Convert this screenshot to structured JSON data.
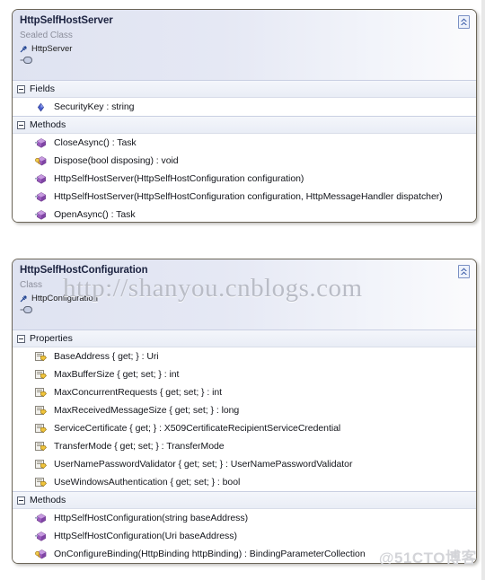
{
  "diagram": {
    "kind": "class-diagram",
    "background_color": "#ffffff",
    "accent_color": "#dfe3f1",
    "border_color": "#6b6558",
    "collapse_icon": "chevron-up-double-icon",
    "expander_icon": "minus-box-icon",
    "base_arrow_icon": "inheritance-arrow-icon",
    "lollipop_icon": "interface-lollipop-icon"
  },
  "watermarks": {
    "url": "http://shanyou.cnblogs.com",
    "site": "@51CTO博客"
  },
  "shapes": [
    {
      "title": "HttpSelfHostServer",
      "stereotype": "Sealed Class",
      "base": "HttpServer",
      "collapse_label": " ",
      "compartments": [
        {
          "label": "Fields",
          "members": [
            {
              "icon": "field-icon",
              "text": "SecurityKey : string"
            }
          ]
        },
        {
          "label": "Methods",
          "members": [
            {
              "icon": "method-icon",
              "text": "CloseAsync() : Task"
            },
            {
              "icon": "method-protected-icon",
              "text": "Dispose(bool disposing) : void"
            },
            {
              "icon": "method-icon",
              "text": "HttpSelfHostServer(HttpSelfHostConfiguration configuration)"
            },
            {
              "icon": "method-icon",
              "text": "HttpSelfHostServer(HttpSelfHostConfiguration configuration, HttpMessageHandler dispatcher)"
            },
            {
              "icon": "method-icon",
              "text": "OpenAsync() : Task"
            }
          ]
        }
      ]
    },
    {
      "title": "HttpSelfHostConfiguration",
      "stereotype": "Class",
      "base": "HttpConfiguration",
      "collapse_label": " ",
      "compartments": [
        {
          "label": "Properties",
          "members": [
            {
              "icon": "property-icon",
              "text": "BaseAddress { get; } : Uri"
            },
            {
              "icon": "property-icon",
              "text": "MaxBufferSize { get; set; } : int"
            },
            {
              "icon": "property-icon",
              "text": "MaxConcurrentRequests { get; set; } : int"
            },
            {
              "icon": "property-icon",
              "text": "MaxReceivedMessageSize { get; set; } : long"
            },
            {
              "icon": "property-icon",
              "text": "ServiceCertificate { get; } : X509CertificateRecipientServiceCredential"
            },
            {
              "icon": "property-icon",
              "text": "TransferMode { get; set; } : TransferMode"
            },
            {
              "icon": "property-icon",
              "text": "UserNamePasswordValidator { get; set; } : UserNamePasswordValidator"
            },
            {
              "icon": "property-icon",
              "text": "UseWindowsAuthentication { get; set; } : bool"
            }
          ]
        },
        {
          "label": "Methods",
          "members": [
            {
              "icon": "method-icon",
              "text": "HttpSelfHostConfiguration(string baseAddress)"
            },
            {
              "icon": "method-icon",
              "text": "HttpSelfHostConfiguration(Uri baseAddress)"
            },
            {
              "icon": "method-protected-icon",
              "text": "OnConfigureBinding(HttpBinding httpBinding) : BindingParameterCollection"
            }
          ]
        }
      ]
    }
  ]
}
